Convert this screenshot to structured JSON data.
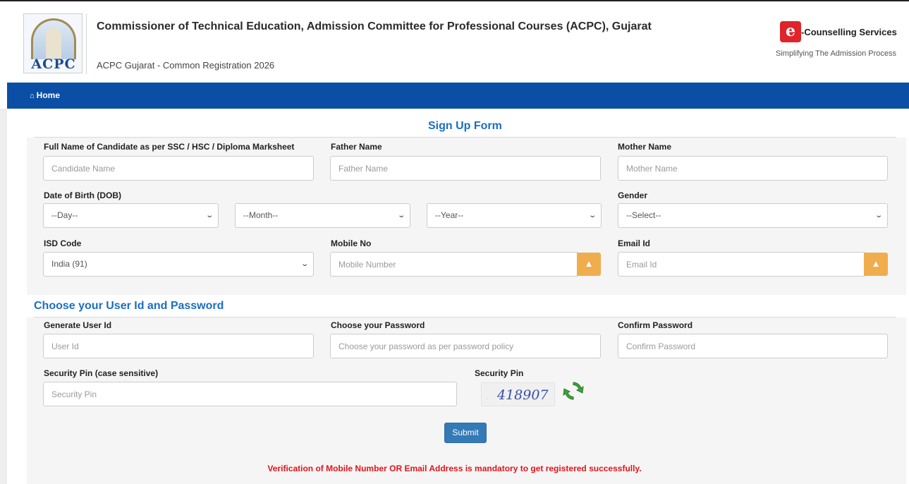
{
  "header": {
    "logo_text": "ACPC",
    "title": "Commissioner of Technical Education, Admission Committee for Professional Courses (ACPC), Gujarat",
    "subtitle": "ACPC Gujarat - Common Registration 2026",
    "brand_name": "-Counselling Services",
    "brand_tagline": "Simplifying The Admission Process",
    "brand_icon": "e-counselling-logo"
  },
  "nav": {
    "home_label": "Home",
    "home_icon": "home-icon"
  },
  "signup": {
    "title": "Sign Up Form",
    "full_name_label": "Full Name of Candidate as per SSC / HSC / Diploma Marksheet",
    "full_name_placeholder": "Candidate Name",
    "father_label": "Father Name",
    "father_placeholder": "Father Name",
    "mother_label": "Mother Name",
    "mother_placeholder": "Mother Name",
    "dob_label": "Date of Birth (DOB)",
    "day_value": "--Day--",
    "month_value": "--Month--",
    "year_value": "--Year--",
    "gender_label": "Gender",
    "gender_value": "--Select--",
    "isd_label": "ISD Code",
    "isd_value": "India (91)",
    "mobile_label": "Mobile No",
    "mobile_placeholder": "Mobile Number",
    "email_label": "Email Id",
    "email_placeholder": "Email Id",
    "warn_icon": "warning-icon"
  },
  "credentials": {
    "title": "Choose your User Id and Password",
    "userid_label": "Generate User Id",
    "userid_placeholder": "User Id",
    "password_label": "Choose your Password",
    "password_placeholder": "Choose your password as per password policy",
    "confirm_label": "Confirm Password",
    "confirm_placeholder": "Confirm Password",
    "pin_label": "Security Pin (case sensitive)",
    "pin_placeholder": "Security Pin",
    "captcha_label": "Security Pin",
    "captcha_text": "418907",
    "refresh_icon": "refresh-icon"
  },
  "submit_label": "Submit",
  "notice": "Verification of Mobile Number OR Email Address is mandatory to get registered successfully.",
  "colors": {
    "navbar": "#0b4ea6",
    "section_title": "#1b6ec2",
    "warn": "#f0ad4e",
    "submit": "#337ab7",
    "notice": "#e2141a"
  }
}
